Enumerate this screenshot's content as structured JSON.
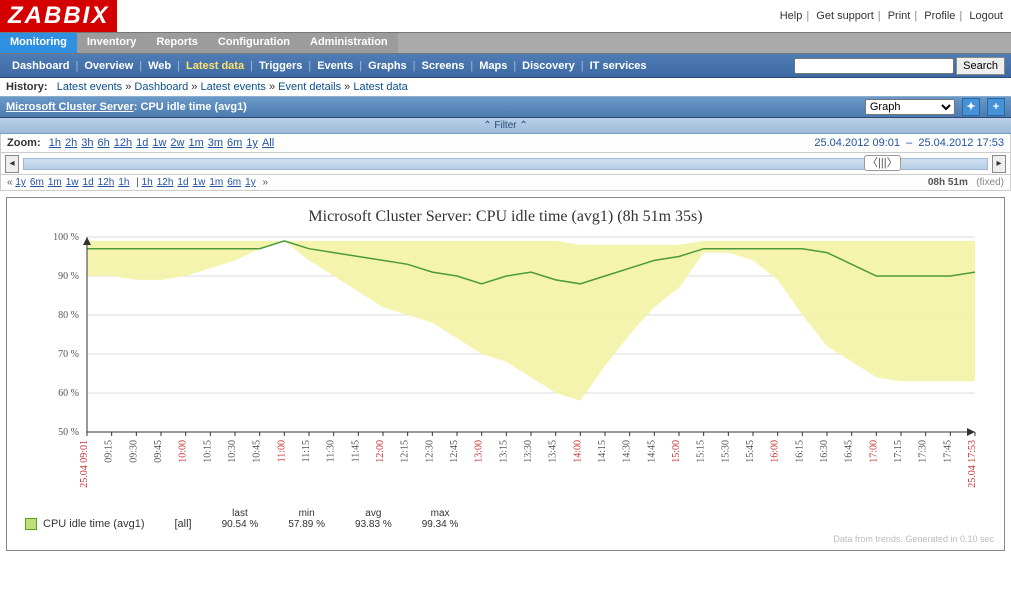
{
  "header": {
    "logo": "ZABBIX",
    "links": {
      "help": "Help",
      "support": "Get support",
      "print": "Print",
      "profile": "Profile",
      "logout": "Logout"
    }
  },
  "tabs": [
    "Monitoring",
    "Inventory",
    "Reports",
    "Configuration",
    "Administration"
  ],
  "subnav": [
    "Dashboard",
    "Overview",
    "Web",
    "Latest data",
    "Triggers",
    "Events",
    "Graphs",
    "Screens",
    "Maps",
    "Discovery",
    "IT services"
  ],
  "subnav_active": "Latest data",
  "search_button": "Search",
  "history_label": "History:",
  "history": [
    "Latest events",
    "Dashboard",
    "Latest events",
    "Event details",
    "Latest data"
  ],
  "title": {
    "host": "Microsoft Cluster Server",
    "suffix": ": CPU idle time (avg1)"
  },
  "view_select": "Graph",
  "filter_label": "Filter",
  "zoom_label": "Zoom:",
  "zoom_options": [
    "1h",
    "2h",
    "3h",
    "6h",
    "12h",
    "1d",
    "1w",
    "2w",
    "1m",
    "3m",
    "6m",
    "1y",
    "All"
  ],
  "date_from": "25.04.2012 09:01",
  "date_to": "25.04.2012 17:53",
  "mini_left": [
    "1y",
    "6m",
    "1m",
    "1w",
    "1d",
    "12h",
    "1h"
  ],
  "mini_right": [
    "1h",
    "12h",
    "1d",
    "1w",
    "1m",
    "6m",
    "1y"
  ],
  "duration": "08h 51m",
  "fixed": "(fixed)",
  "chart_data": {
    "type": "area",
    "title": "Microsoft Cluster Server: CPU idle time (avg1) (8h 51m 35s)",
    "ylabel": "%",
    "ylim": [
      50,
      100
    ],
    "x_labels": [
      "25.04 09:01",
      "09:15",
      "09:30",
      "09:45",
      "10:00",
      "10:15",
      "10:30",
      "10:45",
      "11:00",
      "11:15",
      "11:30",
      "11:45",
      "12:00",
      "12:15",
      "12:30",
      "12:45",
      "13:00",
      "13:15",
      "13:30",
      "13:45",
      "14:00",
      "14:15",
      "14:30",
      "14:45",
      "15:00",
      "15:15",
      "15:30",
      "15:45",
      "16:00",
      "16:15",
      "16:30",
      "16:45",
      "17:00",
      "17:15",
      "17:30",
      "17:45",
      "25.04 17:53"
    ],
    "red_labels": [
      "25.04 09:01",
      "10:00",
      "11:00",
      "12:00",
      "13:00",
      "14:00",
      "15:00",
      "16:00",
      "17:00",
      "25.04 17:53"
    ],
    "series": [
      {
        "name": "CPU idle time (avg1)",
        "avg": [
          97,
          97,
          97,
          97,
          97,
          97,
          97,
          97,
          99,
          97,
          96,
          95,
          94,
          93,
          91,
          90,
          88,
          90,
          91,
          89,
          88,
          90,
          92,
          94,
          95,
          97,
          97,
          97,
          97,
          97,
          96,
          93,
          90,
          90,
          90,
          90,
          91
        ],
        "upper": [
          99,
          99,
          99,
          99,
          99,
          99,
          99,
          99,
          99,
          99,
          99,
          99,
          99,
          99,
          99,
          99,
          99,
          99,
          99,
          99,
          98,
          98,
          98,
          98,
          98,
          99,
          99,
          99,
          99,
          99,
          99,
          99,
          99,
          99,
          99,
          99,
          99
        ],
        "lower": [
          90,
          90,
          89,
          89,
          90,
          92,
          94,
          97,
          99,
          94,
          90,
          86,
          82,
          80,
          78,
          74,
          70,
          68,
          64,
          60,
          58,
          67,
          75,
          82,
          87,
          96,
          96,
          94,
          89,
          80,
          72,
          68,
          64,
          63,
          63,
          63,
          63
        ]
      }
    ]
  },
  "legend": {
    "name": "CPU idle time (avg1)",
    "scope": "[all]",
    "last_h": "last",
    "min_h": "min",
    "avg_h": "avg",
    "max_h": "max",
    "last": "90.54 %",
    "min": "57.89 %",
    "avg": "93.83 %",
    "max": "99.34 %"
  },
  "footer": "Data from trends. Generated in 0.10 sec"
}
